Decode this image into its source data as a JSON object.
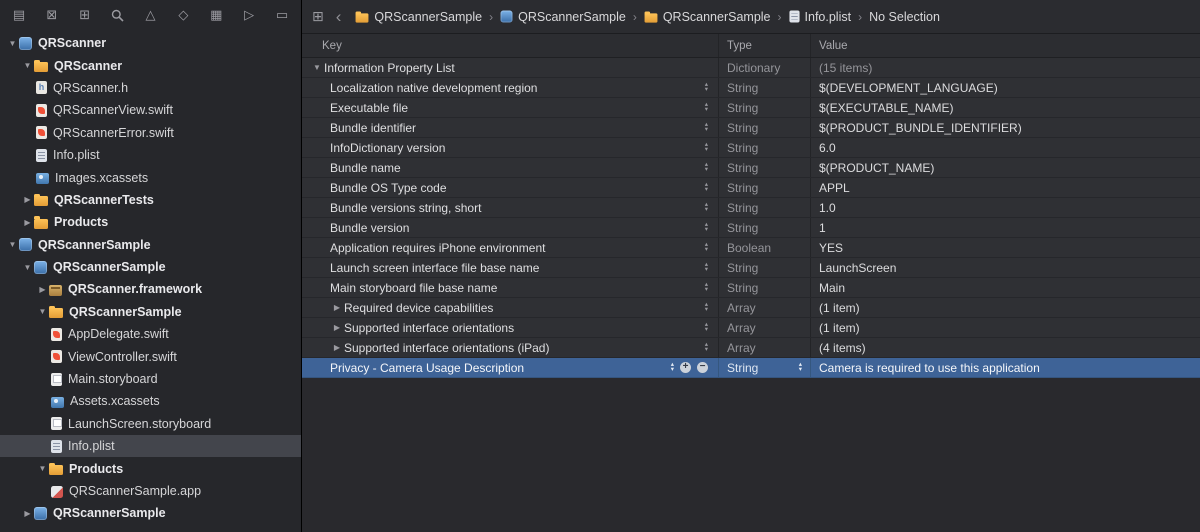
{
  "colors": {
    "selection_blue": "#3e6397",
    "sidebar_selection": "#43454c",
    "folder_yellow": "#fdc257"
  },
  "sidebar": {
    "navigator_icons": [
      {
        "name": "project-navigator-icon",
        "glyph": "▤"
      },
      {
        "name": "source-control-icon",
        "glyph": "⊠"
      },
      {
        "name": "symbol-navigator-icon",
        "glyph": "⊞"
      },
      {
        "name": "search-icon",
        "glyph": "svg-magnifier"
      },
      {
        "name": "issue-navigator-icon",
        "glyph": "△"
      },
      {
        "name": "test-navigator-icon",
        "glyph": "◇"
      },
      {
        "name": "debug-navigator-icon",
        "glyph": "▦"
      },
      {
        "name": "breakpoint-navigator-icon",
        "glyph": "▷"
      },
      {
        "name": "report-navigator-icon",
        "glyph": "▭"
      }
    ],
    "tree": [
      {
        "label": "QRScanner",
        "depth": 0,
        "icon": "project",
        "disclosure": "open",
        "bold": true
      },
      {
        "label": "QRScanner",
        "depth": 1,
        "icon": "folder",
        "disclosure": "open",
        "bold": true
      },
      {
        "label": "QRScanner.h",
        "depth": 2,
        "icon": "header"
      },
      {
        "label": "QRScannerView.swift",
        "depth": 2,
        "icon": "swift"
      },
      {
        "label": "QRScannerError.swift",
        "depth": 2,
        "icon": "swift"
      },
      {
        "label": "Info.plist",
        "depth": 2,
        "icon": "plist"
      },
      {
        "label": "Images.xcassets",
        "depth": 2,
        "icon": "assets"
      },
      {
        "label": "QRScannerTests",
        "depth": 1,
        "icon": "folder",
        "disclosure": "closed",
        "bold": true
      },
      {
        "label": "Products",
        "depth": 1,
        "icon": "folder",
        "disclosure": "closed",
        "bold": true
      },
      {
        "label": "QRScannerSample",
        "depth": 0,
        "icon": "project",
        "disclosure": "open",
        "bold": true
      },
      {
        "label": "QRScannerSample",
        "depth": 1,
        "icon": "project",
        "disclosure": "open",
        "bold": true
      },
      {
        "label": "QRScanner.framework",
        "depth": 2,
        "icon": "framework",
        "disclosure": "closed",
        "bold": true
      },
      {
        "label": "QRScannerSample",
        "depth": 2,
        "icon": "folder",
        "disclosure": "open",
        "bold": true
      },
      {
        "label": "AppDelegate.swift",
        "depth": 3,
        "icon": "swift"
      },
      {
        "label": "ViewController.swift",
        "depth": 3,
        "icon": "swift"
      },
      {
        "label": "Main.storyboard",
        "depth": 3,
        "icon": "storyboard"
      },
      {
        "label": "Assets.xcassets",
        "depth": 3,
        "icon": "assets"
      },
      {
        "label": "LaunchScreen.storyboard",
        "depth": 3,
        "icon": "storyboard"
      },
      {
        "label": "Info.plist",
        "depth": 3,
        "icon": "plist",
        "selected": true
      },
      {
        "label": "Products",
        "depth": 2,
        "icon": "folder",
        "disclosure": "open",
        "bold": true
      },
      {
        "label": "QRScannerSample.app",
        "depth": 3,
        "icon": "app"
      },
      {
        "label": "QRScannerSample",
        "depth": 1,
        "icon": "project",
        "disclosure": "closed",
        "bold": true
      }
    ]
  },
  "jumpbar": {
    "related_items_glyph": "⊞",
    "back_glyph": "‹",
    "separator": "›",
    "segments": [
      {
        "icon": "folder",
        "label": "QRScannerSample"
      },
      {
        "icon": "project",
        "label": "QRScannerSample"
      },
      {
        "icon": "folder",
        "label": "QRScannerSample"
      },
      {
        "icon": "plist",
        "label": "Info.plist"
      },
      {
        "icon": null,
        "label": "No Selection"
      }
    ]
  },
  "table": {
    "columns": [
      "Key",
      "Type",
      "Value"
    ],
    "rows": [
      {
        "key": "Information Property List",
        "depth": 0,
        "disclosure": "open",
        "type": "Dictionary",
        "value": "(15 items)",
        "muted": true
      },
      {
        "key": "Localization native development region",
        "depth": 1,
        "stepper": true,
        "type": "String",
        "value": "$(DEVELOPMENT_LANGUAGE)"
      },
      {
        "key": "Executable file",
        "depth": 1,
        "stepper": true,
        "type": "String",
        "value": "$(EXECUTABLE_NAME)"
      },
      {
        "key": "Bundle identifier",
        "depth": 1,
        "stepper": true,
        "type": "String",
        "value": "$(PRODUCT_BUNDLE_IDENTIFIER)"
      },
      {
        "key": "InfoDictionary version",
        "depth": 1,
        "stepper": true,
        "type": "String",
        "value": "6.0"
      },
      {
        "key": "Bundle name",
        "depth": 1,
        "stepper": true,
        "type": "String",
        "value": "$(PRODUCT_NAME)"
      },
      {
        "key": "Bundle OS Type code",
        "depth": 1,
        "stepper": true,
        "type": "String",
        "value": "APPL"
      },
      {
        "key": "Bundle versions string, short",
        "depth": 1,
        "stepper": true,
        "type": "String",
        "value": "1.0"
      },
      {
        "key": "Bundle version",
        "depth": 1,
        "stepper": true,
        "type": "String",
        "value": "1"
      },
      {
        "key": "Application requires iPhone environment",
        "depth": 1,
        "stepper": true,
        "type": "Boolean",
        "value": "YES"
      },
      {
        "key": "Launch screen interface file base name",
        "depth": 1,
        "stepper": true,
        "type": "String",
        "value": "LaunchScreen"
      },
      {
        "key": "Main storyboard file base name",
        "depth": 1,
        "stepper": true,
        "type": "String",
        "value": "Main"
      },
      {
        "key": "Required device capabilities",
        "depth": 1,
        "disclosure": "closed",
        "stepper": true,
        "type": "Array",
        "value": "(1 item)"
      },
      {
        "key": "Supported interface orientations",
        "depth": 1,
        "disclosure": "closed",
        "stepper": true,
        "type": "Array",
        "value": "(1 item)"
      },
      {
        "key": "Supported interface orientations (iPad)",
        "depth": 1,
        "disclosure": "closed",
        "stepper": true,
        "type": "Array",
        "value": "(4 items)"
      },
      {
        "key": "Privacy - Camera Usage Description",
        "depth": 1,
        "stepper": true,
        "type": "String",
        "value": "Camera is required to use this application",
        "selected": true,
        "add_remove": true,
        "type_stepper": true
      }
    ]
  }
}
